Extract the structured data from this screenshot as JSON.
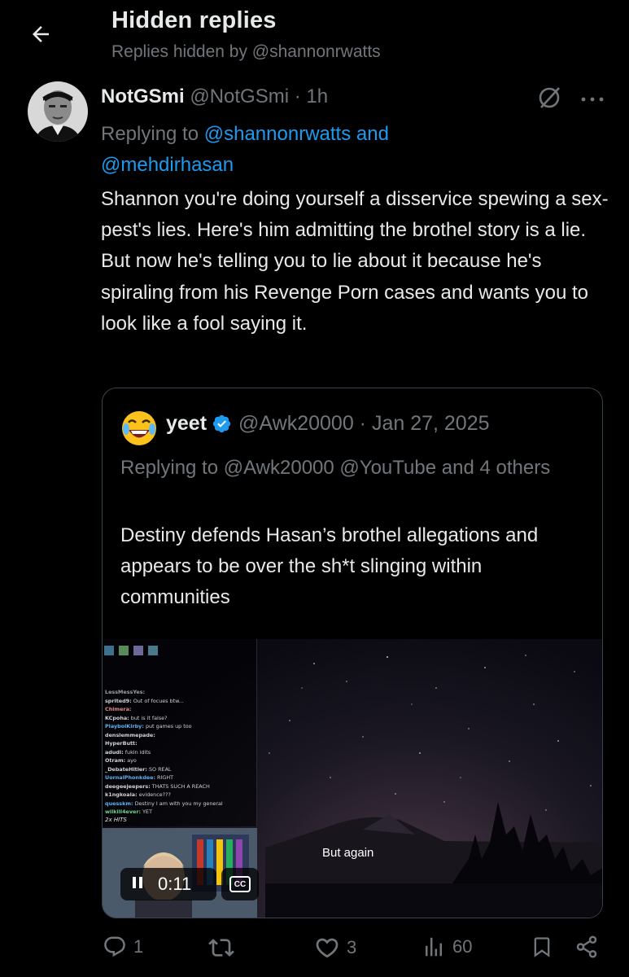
{
  "header": {
    "title": "Hidden replies",
    "subtitle": "Replies hidden by @shannonrwatts"
  },
  "tweet": {
    "author_name": "NotGSmi",
    "author_handle": "@NotGSmi · 1h",
    "replying_prefix": "Replying to ",
    "replying_to_1": "@shannonrwatts and",
    "replying_to_2": "@mehdirhasan",
    "text": "Shannon you're doing yourself a disservice spewing a sex-pest's lies. Here's him admitting the brothel story is a lie. But now he's telling you to lie about it because he's spiraling from his Revenge Porn cases and wants you to look like a fool saying it."
  },
  "quote": {
    "author_name": "yeet",
    "author_handle": "@Awk20000 · Jan 27, 2025",
    "replying": "Replying to @Awk20000 @YouTube and 4 others",
    "text": "Destiny defends Hasan’s brothel allegations and appears to be over the sh*t slinging within communities",
    "video": {
      "caption": "But again",
      "time": "0:11",
      "cc_label": "CC",
      "chat": [
        {
          "user": "LessMessYes:",
          "msg": "",
          "color": "#9aa0a6"
        },
        {
          "user": "sprited9:",
          "msg": "Out of focues btw...",
          "color": "#cfd2d6"
        },
        {
          "user": "Chimera:",
          "msg": "",
          "color": "#e08a8a"
        },
        {
          "user": "KCpoha:",
          "msg": "but is it false?",
          "color": "#cfd2d6"
        },
        {
          "user": "PlaybolKirby:",
          "msg": "put games up too",
          "color": "#5fb0f0"
        },
        {
          "user": "denslemmepade:",
          "msg": "",
          "color": "#cfd2d6"
        },
        {
          "user": "HyperButt:",
          "msg": "",
          "color": "#cfd2d6"
        },
        {
          "user": "adudi:",
          "msg": "fukin idits",
          "color": "#cfd2d6"
        },
        {
          "user": "Otram:",
          "msg": "ayo",
          "color": "#cfd2d6"
        },
        {
          "user": "_DebateHitler:",
          "msg": "SO REAL",
          "color": "#cfd2d6"
        },
        {
          "user": "UornalPhonkdee:",
          "msg": "RIGHT",
          "color": "#5fb0f0"
        },
        {
          "user": "deegeejeepers:",
          "msg": "THATS SUCH A REACH",
          "color": "#cfd2d6"
        },
        {
          "user": "k1ngkoala:",
          "msg": "evidence???",
          "color": "#cfd2d6"
        },
        {
          "user": "quesskm:",
          "msg": "Destiny I am with you my general",
          "color": "#5fb0f0"
        },
        {
          "user": "wilkill4ever:",
          "msg": "YET",
          "color": "#6fd08a"
        }
      ],
      "hits": "2x HITS"
    }
  },
  "actions": {
    "replies": "1",
    "retweets": "",
    "likes": "3",
    "views": "60"
  },
  "colors": {
    "background": "#000000",
    "text_primary": "#e7e9ea",
    "text_secondary": "#71767b",
    "link": "#1d9bf0",
    "verified": "#1d9bf0",
    "border": "#38444d"
  }
}
